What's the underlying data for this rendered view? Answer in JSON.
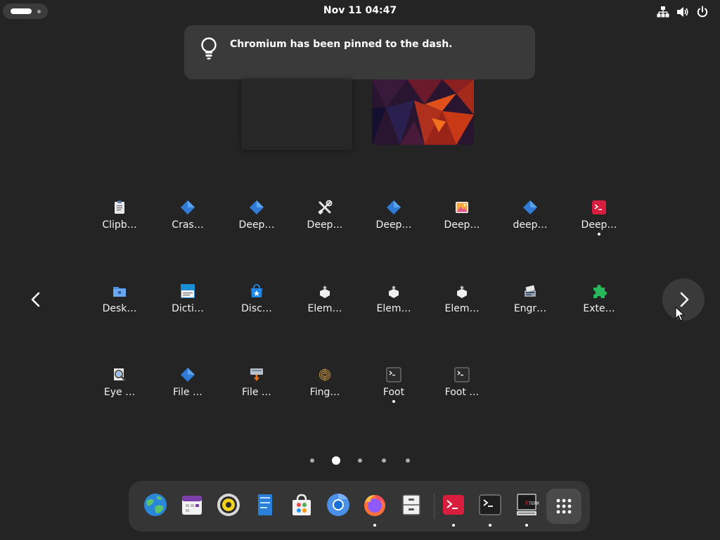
{
  "topbar": {
    "clock": "Nov 11  04:47",
    "icons": [
      "network-wired-icon",
      "volume-icon",
      "power-icon"
    ]
  },
  "notification": {
    "icon": "lightbulb-icon",
    "message": "Chromium has been pinned to the dash."
  },
  "app_grid": {
    "apps": [
      {
        "label": "Clipb…",
        "icon": "clipboard-icon",
        "running": false
      },
      {
        "label": "Cras…",
        "icon": "deepin-diamond-icon",
        "running": false
      },
      {
        "label": "Deep…",
        "icon": "deepin-diamond-icon",
        "running": false
      },
      {
        "label": "Deep…",
        "icon": "tools-icon",
        "running": false
      },
      {
        "label": "Deep…",
        "icon": "deepin-diamond-icon",
        "running": false
      },
      {
        "label": "Deep…",
        "icon": "image-viewer-icon",
        "running": false
      },
      {
        "label": "deep…",
        "icon": "deepin-diamond-icon",
        "running": false
      },
      {
        "label": "Deep…",
        "icon": "deepin-terminal-icon",
        "running": true
      },
      {
        "label": "Desk…",
        "icon": "folder-icon",
        "running": false
      },
      {
        "label": "Dicti…",
        "icon": "dictionary-icon",
        "running": false
      },
      {
        "label": "Disc…",
        "icon": "software-store-icon",
        "running": false
      },
      {
        "label": "Elem…",
        "icon": "element-icon",
        "running": false
      },
      {
        "label": "Elem…",
        "icon": "element-icon",
        "running": false
      },
      {
        "label": "Elem…",
        "icon": "element-icon",
        "running": false
      },
      {
        "label": "Engr…",
        "icon": "engrampa-icon",
        "running": false
      },
      {
        "label": "Exte…",
        "icon": "puzzle-piece-icon",
        "running": false
      },
      {
        "label": "Eye …",
        "icon": "eye-of-gnome-icon",
        "running": false
      },
      {
        "label": "File …",
        "icon": "deepin-diamond-icon",
        "running": false
      },
      {
        "label": "File …",
        "icon": "file-transfer-icon",
        "running": false
      },
      {
        "label": "Fing…",
        "icon": "fingerprint-icon",
        "running": false
      },
      {
        "label": "Foot",
        "icon": "foot-terminal-icon",
        "running": true
      },
      {
        "label": "Foot …",
        "icon": "foot-terminal-icon",
        "running": false
      }
    ],
    "pages": 5,
    "active_page": 1
  },
  "dash": {
    "items": [
      {
        "icon": "web-browser-globe-icon",
        "running": false
      },
      {
        "icon": "calendar-icon",
        "running": false
      },
      {
        "icon": "rhythmbox-icon",
        "running": false
      },
      {
        "icon": "document-viewer-icon",
        "running": false
      },
      {
        "icon": "software-center-icon",
        "running": false
      },
      {
        "icon": "chromium-icon",
        "running": false
      },
      {
        "icon": "firefox-icon",
        "running": true
      },
      {
        "icon": "file-cabinet-icon",
        "running": false
      },
      {
        "icon": "deepin-terminal-icon",
        "running": true
      },
      {
        "icon": "foot-terminal-icon",
        "running": true
      },
      {
        "icon": "xterm-icon",
        "running": true
      }
    ],
    "show_apps_icon": "grid-icon"
  }
}
